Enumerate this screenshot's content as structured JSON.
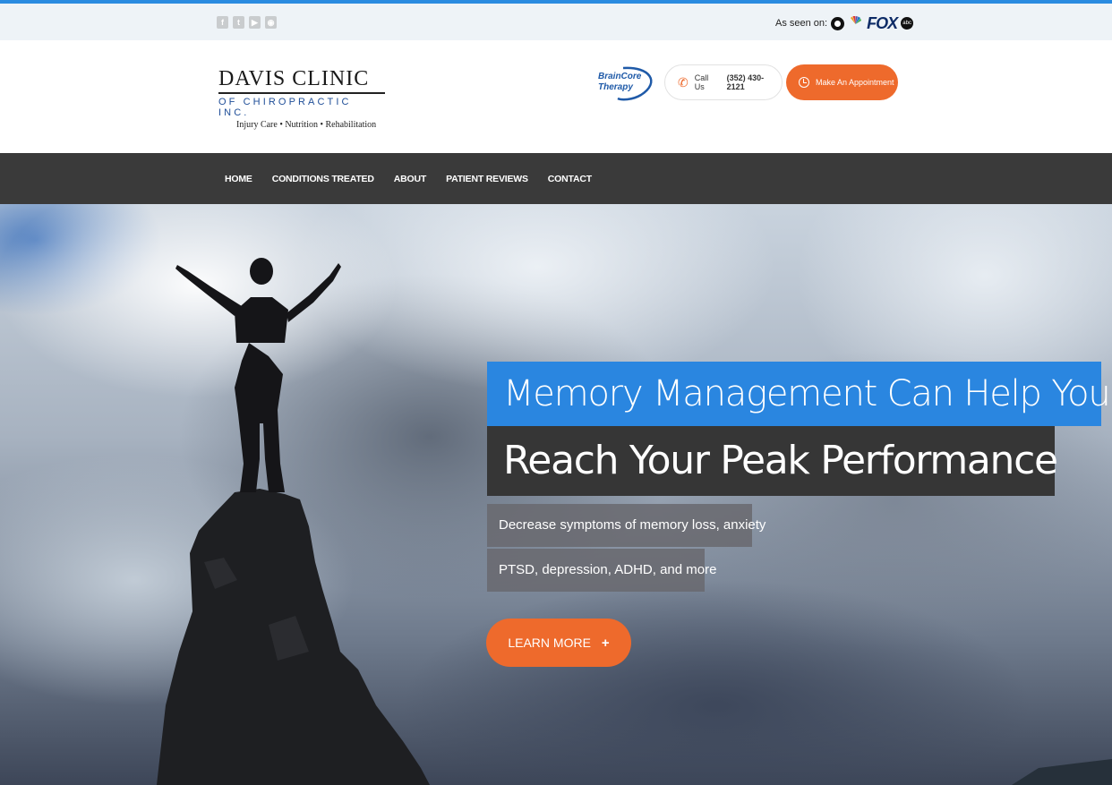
{
  "topbar": {
    "social_icons": [
      {
        "name": "facebook-icon",
        "glyph": "f"
      },
      {
        "name": "twitter-icon",
        "glyph": "t"
      },
      {
        "name": "youtube-icon",
        "glyph": "▶"
      },
      {
        "name": "rss-icon",
        "glyph": "◉"
      }
    ],
    "as_seen_on": "As seen on:",
    "networks": {
      "fox": "FOX",
      "nbc": "NBC",
      "abc": "abc"
    }
  },
  "header": {
    "logo_main": "DAVIS CLINIC",
    "logo_sub": "OF CHIROPRACTIC INC.",
    "logo_tagline": "Injury Care • Nutrition • Rehabilitation",
    "braincore_line1": "BrainCore",
    "braincore_line2": "Therapy",
    "call_label": "Call Us",
    "call_number": "(352) 430-2121",
    "appointment_label": "Make An Appointment"
  },
  "nav": {
    "items": [
      "HOME",
      "CONDITIONS TREATED",
      "ABOUT",
      "PATIENT REVIEWS",
      "CONTACT"
    ]
  },
  "hero": {
    "headline1": "Memory Management Can Help You",
    "headline2": "Reach Your Peak Performance",
    "sub1": "Decrease symptoms of memory loss, anxiety",
    "sub2": "PTSD, depression, ADHD, and more",
    "cta_label": "LEARN MORE",
    "cta_plus": "+"
  },
  "colors": {
    "accent_orange": "#ee6a2c",
    "accent_blue": "#2a86e0",
    "nav_bg": "#3a3a3a",
    "topbar_bg": "#eef3f7"
  }
}
